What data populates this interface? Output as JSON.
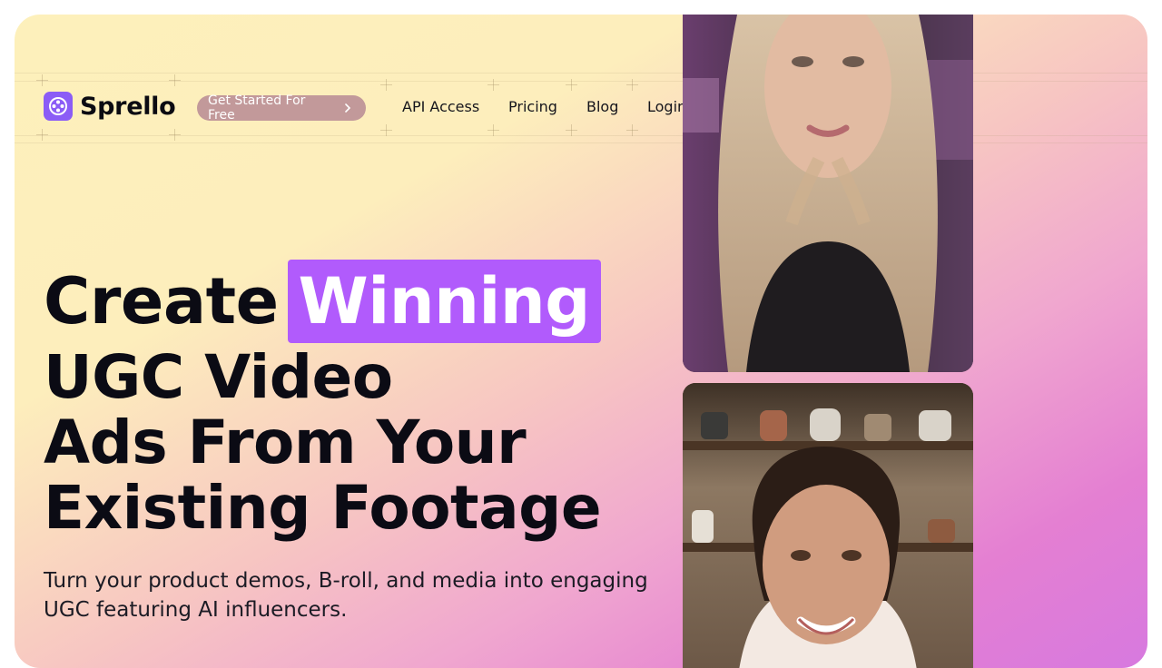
{
  "brand": {
    "name": "Sprello",
    "accent": "#8b5cf6"
  },
  "header": {
    "cta_label": "Get Started For Free",
    "nav": [
      {
        "label": "API Access"
      },
      {
        "label": "Pricing"
      },
      {
        "label": "Blog"
      },
      {
        "label": "Login"
      }
    ]
  },
  "hero": {
    "headline_word1": "Create",
    "headline_highlight": "Winning",
    "headline_line2": "UGC Video",
    "headline_line3": "Ads From Your",
    "headline_line4": "Existing Footage",
    "subtext": "Turn your product demos, B-roll, and media into engaging UGC featuring AI influencers.",
    "highlight_color": "#b15bfc"
  },
  "media": [
    {
      "icon": "influencer-video-blonde"
    },
    {
      "icon": "influencer-video-kitchen"
    }
  ]
}
